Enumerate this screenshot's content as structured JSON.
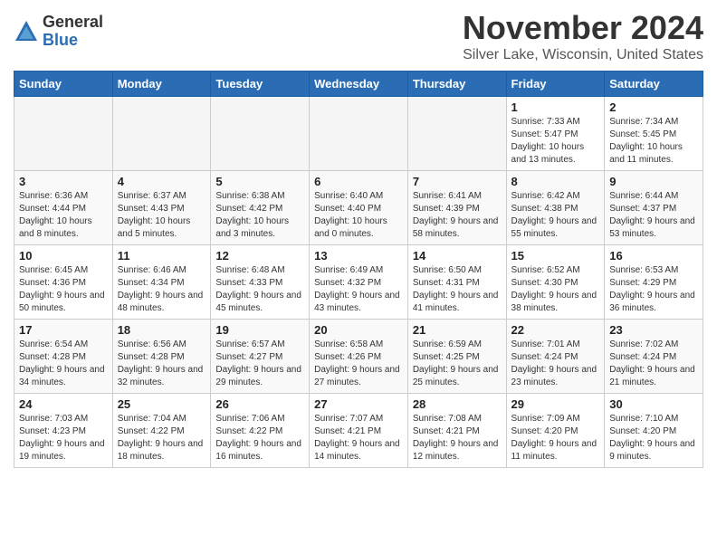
{
  "logo": {
    "general": "General",
    "blue": "Blue"
  },
  "header": {
    "month": "November 2024",
    "location": "Silver Lake, Wisconsin, United States"
  },
  "weekdays": [
    "Sunday",
    "Monday",
    "Tuesday",
    "Wednesday",
    "Thursday",
    "Friday",
    "Saturday"
  ],
  "weeks": [
    [
      {
        "day": "",
        "info": ""
      },
      {
        "day": "",
        "info": ""
      },
      {
        "day": "",
        "info": ""
      },
      {
        "day": "",
        "info": ""
      },
      {
        "day": "",
        "info": ""
      },
      {
        "day": "1",
        "info": "Sunrise: 7:33 AM\nSunset: 5:47 PM\nDaylight: 10 hours and 13 minutes."
      },
      {
        "day": "2",
        "info": "Sunrise: 7:34 AM\nSunset: 5:45 PM\nDaylight: 10 hours and 11 minutes."
      }
    ],
    [
      {
        "day": "3",
        "info": "Sunrise: 6:36 AM\nSunset: 4:44 PM\nDaylight: 10 hours and 8 minutes."
      },
      {
        "day": "4",
        "info": "Sunrise: 6:37 AM\nSunset: 4:43 PM\nDaylight: 10 hours and 5 minutes."
      },
      {
        "day": "5",
        "info": "Sunrise: 6:38 AM\nSunset: 4:42 PM\nDaylight: 10 hours and 3 minutes."
      },
      {
        "day": "6",
        "info": "Sunrise: 6:40 AM\nSunset: 4:40 PM\nDaylight: 10 hours and 0 minutes."
      },
      {
        "day": "7",
        "info": "Sunrise: 6:41 AM\nSunset: 4:39 PM\nDaylight: 9 hours and 58 minutes."
      },
      {
        "day": "8",
        "info": "Sunrise: 6:42 AM\nSunset: 4:38 PM\nDaylight: 9 hours and 55 minutes."
      },
      {
        "day": "9",
        "info": "Sunrise: 6:44 AM\nSunset: 4:37 PM\nDaylight: 9 hours and 53 minutes."
      }
    ],
    [
      {
        "day": "10",
        "info": "Sunrise: 6:45 AM\nSunset: 4:36 PM\nDaylight: 9 hours and 50 minutes."
      },
      {
        "day": "11",
        "info": "Sunrise: 6:46 AM\nSunset: 4:34 PM\nDaylight: 9 hours and 48 minutes."
      },
      {
        "day": "12",
        "info": "Sunrise: 6:48 AM\nSunset: 4:33 PM\nDaylight: 9 hours and 45 minutes."
      },
      {
        "day": "13",
        "info": "Sunrise: 6:49 AM\nSunset: 4:32 PM\nDaylight: 9 hours and 43 minutes."
      },
      {
        "day": "14",
        "info": "Sunrise: 6:50 AM\nSunset: 4:31 PM\nDaylight: 9 hours and 41 minutes."
      },
      {
        "day": "15",
        "info": "Sunrise: 6:52 AM\nSunset: 4:30 PM\nDaylight: 9 hours and 38 minutes."
      },
      {
        "day": "16",
        "info": "Sunrise: 6:53 AM\nSunset: 4:29 PM\nDaylight: 9 hours and 36 minutes."
      }
    ],
    [
      {
        "day": "17",
        "info": "Sunrise: 6:54 AM\nSunset: 4:28 PM\nDaylight: 9 hours and 34 minutes."
      },
      {
        "day": "18",
        "info": "Sunrise: 6:56 AM\nSunset: 4:28 PM\nDaylight: 9 hours and 32 minutes."
      },
      {
        "day": "19",
        "info": "Sunrise: 6:57 AM\nSunset: 4:27 PM\nDaylight: 9 hours and 29 minutes."
      },
      {
        "day": "20",
        "info": "Sunrise: 6:58 AM\nSunset: 4:26 PM\nDaylight: 9 hours and 27 minutes."
      },
      {
        "day": "21",
        "info": "Sunrise: 6:59 AM\nSunset: 4:25 PM\nDaylight: 9 hours and 25 minutes."
      },
      {
        "day": "22",
        "info": "Sunrise: 7:01 AM\nSunset: 4:24 PM\nDaylight: 9 hours and 23 minutes."
      },
      {
        "day": "23",
        "info": "Sunrise: 7:02 AM\nSunset: 4:24 PM\nDaylight: 9 hours and 21 minutes."
      }
    ],
    [
      {
        "day": "24",
        "info": "Sunrise: 7:03 AM\nSunset: 4:23 PM\nDaylight: 9 hours and 19 minutes."
      },
      {
        "day": "25",
        "info": "Sunrise: 7:04 AM\nSunset: 4:22 PM\nDaylight: 9 hours and 18 minutes."
      },
      {
        "day": "26",
        "info": "Sunrise: 7:06 AM\nSunset: 4:22 PM\nDaylight: 9 hours and 16 minutes."
      },
      {
        "day": "27",
        "info": "Sunrise: 7:07 AM\nSunset: 4:21 PM\nDaylight: 9 hours and 14 minutes."
      },
      {
        "day": "28",
        "info": "Sunrise: 7:08 AM\nSunset: 4:21 PM\nDaylight: 9 hours and 12 minutes."
      },
      {
        "day": "29",
        "info": "Sunrise: 7:09 AM\nSunset: 4:20 PM\nDaylight: 9 hours and 11 minutes."
      },
      {
        "day": "30",
        "info": "Sunrise: 7:10 AM\nSunset: 4:20 PM\nDaylight: 9 hours and 9 minutes."
      }
    ]
  ]
}
